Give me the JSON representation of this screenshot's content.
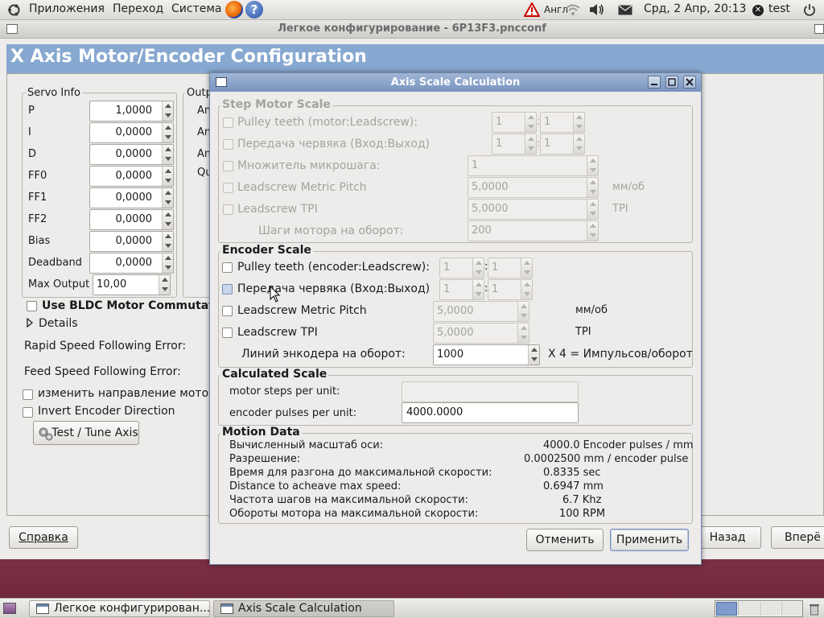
{
  "top_panel": {
    "menus": [
      "Приложения",
      "Переход",
      "Система"
    ],
    "keyboard_layout": "Англ",
    "datetime": "Срд,  2 Апр, 20:13",
    "user": "test"
  },
  "main_window": {
    "title": "Легкое конфигурирование - 6P13F3.pncconf",
    "header": "X Axis Motor/Encoder Configuration",
    "servo_info": {
      "title": "Servo Info",
      "rows": [
        {
          "label": "P",
          "value": "1,0000"
        },
        {
          "label": "I",
          "value": "0,0000"
        },
        {
          "label": "D",
          "value": "0,0000"
        },
        {
          "label": "FF0",
          "value": "0,0000"
        },
        {
          "label": "FF1",
          "value": "0,0000"
        },
        {
          "label": "FF2",
          "value": "0,0000"
        },
        {
          "label": "Bias",
          "value": "0,0000"
        },
        {
          "label": "Deadband",
          "value": "0,0000"
        }
      ],
      "max_output_label": "Max Output",
      "max_output_value": "10,00"
    },
    "output_frame_title": "Outp",
    "output_rows": [
      "An",
      "An",
      "An",
      "Qu"
    ],
    "bldc_label": "Use BLDC Motor Commutati",
    "details_label": "Details",
    "rapid_speed_label": "Rapid Speed Following Error:",
    "feed_speed_label": "Feed Speed Following Error:",
    "change_direction_label": "изменить направление мотор",
    "invert_encoder_label": "Invert Encoder Direction",
    "test_tune_button": "Test / Tune Axis",
    "help_button": "Справка",
    "back_button": "Назад",
    "forward_button": "Вперё"
  },
  "dialog": {
    "title": "Axis Scale Calculation",
    "step_motor_scale": {
      "title": "Step Motor Scale",
      "pulley_label": "Pulley teeth (motor:Leadscrew):",
      "pulley_values": [
        "1",
        "1"
      ],
      "worm_label": "Передача червяка (Вход:Выход)",
      "worm_values": [
        "1",
        "1"
      ],
      "microstep_label": "Множитель микрошага:",
      "microstep_value": "1",
      "metric_pitch_label": "Leadscrew Metric Pitch",
      "metric_pitch_value": "5,0000",
      "metric_pitch_unit": "мм/об",
      "tpi_label": "Leadscrew TPI",
      "tpi_value": "5,0000",
      "tpi_unit": "TPI",
      "steps_per_rev_label": "Шаги мотора на оборот:",
      "steps_per_rev_value": "200"
    },
    "encoder_scale": {
      "title": "Encoder Scale",
      "pulley_label": "Pulley teeth (encoder:Leadscrew):",
      "pulley_values": [
        "1",
        "1"
      ],
      "worm_label": "Передача червяка (Вход:Выход)",
      "worm_values": [
        "1",
        "1"
      ],
      "metric_pitch_label": "Leadscrew Metric Pitch",
      "metric_pitch_value": "5,0000",
      "metric_pitch_unit": "мм/об",
      "tpi_label": "Leadscrew TPI",
      "tpi_value": "5,0000",
      "tpi_unit": "TPI",
      "lines_label": "Линий энкодера на оборот:",
      "lines_value": "1000",
      "lines_note": "X 4 = Импульсов/оборот"
    },
    "calculated_scale": {
      "title": "Calculated Scale",
      "motor_steps_label": "motor steps per unit:",
      "motor_steps_value": "",
      "encoder_pulses_label": "encoder pulses per unit:",
      "encoder_pulses_value": "4000.0000"
    },
    "motion_data": {
      "title": "Motion Data",
      "rows": [
        {
          "label": "Вычисленный масштаб оси:",
          "value": "4000.0 Encoder pulses / mm"
        },
        {
          "label": "Разрешение:",
          "value": "0.0002500 mm / encoder pulse"
        },
        {
          "label": "Время для разгона до максимальной скорости:",
          "value": "0.8335 sec"
        },
        {
          "label": "Distance to acheave max speed:",
          "value": "0.6947 mm"
        },
        {
          "label": "Частота шагов на максимальной скорости:",
          "value": "6.7 Khz"
        },
        {
          "label": "Обороты мотора на максимальной скорости:",
          "value": "100 RPM"
        }
      ]
    },
    "cancel_button": "Отменить",
    "apply_button": "Применить"
  },
  "taskbar": {
    "items": [
      "Легкое конфигурирован...",
      "Axis Scale Calculation"
    ]
  },
  "colors": {
    "header_band": "#87a8d0",
    "dialog_title": "#7894bf"
  }
}
